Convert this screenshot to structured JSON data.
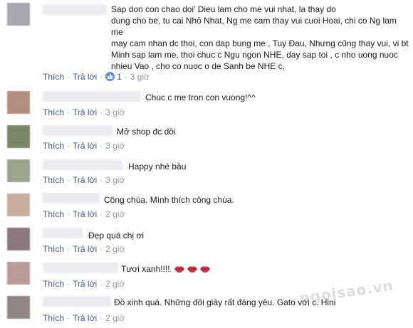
{
  "actions": {
    "like": "Thích",
    "reply": "Trả lời",
    "sep": "·"
  },
  "comments": [
    {
      "text": "Sap don con chao doi' Dieu lam cho me vui nhat, la thay do\ndung cho be, tu cai Nhỏ Nhat, Ng me cam thay vui cuoi Hoai, chi co Ng lam me\nmay cam nhan dc thoi, con dap bung me , Tuy Đau, Nhưng cũng thay vui, vi bt\nMinh sap lam me, thoi chuc c Ngu ngon NHE, day sap toi , c nho uong nuoc\nnhieu Vao , cho co nuoc o de Sanh be NHE c,",
      "likes": "1",
      "time": "3 giờ",
      "avatar_color": "#a9a6b4"
    },
    {
      "text": "Chuc c me tron con vuong!^^",
      "time": "3 giờ",
      "avatar_color": "#b58e82"
    },
    {
      "text": "Mở shop đc dồi",
      "time": "3 giờ",
      "avatar_color": "#7a8868"
    },
    {
      "text": "Happy nhé bầu",
      "time": "3 giờ",
      "avatar_color": "#9aa48c"
    },
    {
      "text": "Công chúa. Mình thích công chúa.",
      "time": "2 giờ",
      "avatar_color": "#c7aea0"
    },
    {
      "text": "Đẹp quá chị ơi",
      "time": "2 giờ",
      "avatar_color": "#8c7a80"
    },
    {
      "text": "Tươi xanh!!!!",
      "time": "2 giờ",
      "avatar_color": "#b89a96"
    },
    {
      "text": "Đồ xinh quá. Những đôi giày rất đáng yêu. Gato với c. Hini",
      "time": "2 giờ",
      "avatar_color": "#8f8783"
    }
  ],
  "watermark": "ngoisao.vn"
}
